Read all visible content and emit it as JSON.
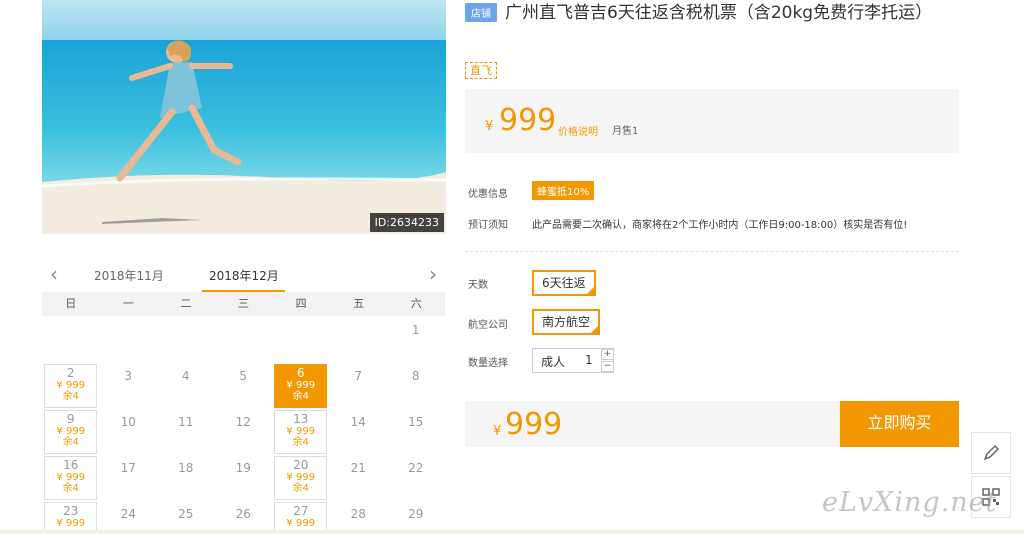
{
  "hero": {
    "image_id": "ID:2634233"
  },
  "calendar": {
    "prev_month": "2018年11月",
    "current_month": "2018年12月",
    "weekdays": [
      "日",
      "一",
      "二",
      "三",
      "四",
      "五",
      "六"
    ],
    "cells": [
      {
        "row": 0,
        "col": 6,
        "day": "1"
      },
      {
        "row": 1,
        "col": 0,
        "day": "2",
        "price": "¥ 999",
        "remain": "余4"
      },
      {
        "row": 1,
        "col": 1,
        "day": "3"
      },
      {
        "row": 1,
        "col": 2,
        "day": "4"
      },
      {
        "row": 1,
        "col": 3,
        "day": "5"
      },
      {
        "row": 1,
        "col": 4,
        "day": "6",
        "price": "¥ 999",
        "remain": "余4",
        "selected": true
      },
      {
        "row": 1,
        "col": 5,
        "day": "7"
      },
      {
        "row": 1,
        "col": 6,
        "day": "8"
      },
      {
        "row": 2,
        "col": 0,
        "day": "9",
        "price": "¥ 999",
        "remain": "余4"
      },
      {
        "row": 2,
        "col": 1,
        "day": "10"
      },
      {
        "row": 2,
        "col": 2,
        "day": "11"
      },
      {
        "row": 2,
        "col": 3,
        "day": "12"
      },
      {
        "row": 2,
        "col": 4,
        "day": "13",
        "price": "¥ 999",
        "remain": "余4"
      },
      {
        "row": 2,
        "col": 5,
        "day": "14"
      },
      {
        "row": 2,
        "col": 6,
        "day": "15"
      },
      {
        "row": 3,
        "col": 0,
        "day": "16",
        "price": "¥ 999",
        "remain": "余4"
      },
      {
        "row": 3,
        "col": 1,
        "day": "17"
      },
      {
        "row": 3,
        "col": 2,
        "day": "18"
      },
      {
        "row": 3,
        "col": 3,
        "day": "19"
      },
      {
        "row": 3,
        "col": 4,
        "day": "20",
        "price": "¥ 999",
        "remain": "余4"
      },
      {
        "row": 3,
        "col": 5,
        "day": "21"
      },
      {
        "row": 3,
        "col": 6,
        "day": "22"
      },
      {
        "row": 4,
        "col": 0,
        "day": "23",
        "price": "¥ 999"
      },
      {
        "row": 4,
        "col": 1,
        "day": "24"
      },
      {
        "row": 4,
        "col": 2,
        "day": "25"
      },
      {
        "row": 4,
        "col": 3,
        "day": "26"
      },
      {
        "row": 4,
        "col": 4,
        "day": "27",
        "price": "¥ 999"
      },
      {
        "row": 4,
        "col": 5,
        "day": "28"
      },
      {
        "row": 4,
        "col": 6,
        "day": "29"
      }
    ]
  },
  "product": {
    "shop_badge": "店铺",
    "title": "广州直飞普吉6天往返含税机票（含20kg免费行李托运）",
    "direct_tag": "直飞",
    "currency": "¥",
    "price": "999",
    "price_note": "价格说明",
    "monthly_sales": "月售1",
    "promo_label": "优惠信息",
    "promo_tag": "蜂蜜抵10%",
    "notice_label": "预订须知",
    "notice_text": "此产品需要二次确认，商家将在2个工作小时内（工作日9:00-18:00）核实是否有位!",
    "days_label": "天数",
    "days_value": "6天往返",
    "airline_label": "航空公司",
    "airline_value": "南方航空",
    "qty_label": "数量选择",
    "qty_type": "成人",
    "qty_value": "1",
    "qty_plus": "+",
    "qty_minus": "−",
    "total_price": "999",
    "buy_button": "立即购买"
  },
  "watermark": "eLvXing.net",
  "colors": {
    "accent": "#f39800",
    "shop_badge": "#6fa4e8"
  },
  "icons": [
    "chevron-left-icon",
    "chevron-right-icon",
    "pencil-icon",
    "qrcode-icon"
  ]
}
